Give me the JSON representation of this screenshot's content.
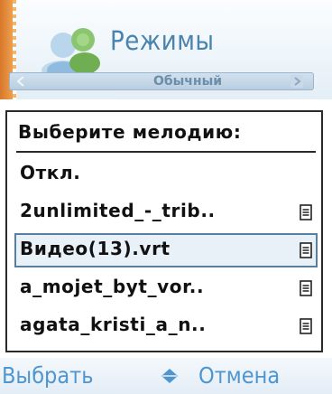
{
  "header": {
    "title": "Режимы",
    "mode_tab": "Обычный"
  },
  "dialog": {
    "heading": "Выберите мелодию:",
    "items": [
      {
        "label": "Откл.",
        "has_file_icon": false,
        "selected": false
      },
      {
        "label": "2unlimited_-_trib..",
        "has_file_icon": true,
        "selected": false
      },
      {
        "label": "Видео(13).vrt",
        "has_file_icon": true,
        "selected": true
      },
      {
        "label": "a_mojet_byt_vor..",
        "has_file_icon": true,
        "selected": false
      },
      {
        "label": "agata_kristi_a_n..",
        "has_file_icon": true,
        "selected": false
      }
    ]
  },
  "softkeys": {
    "left": "Выбрать",
    "right": "Отмена",
    "center_icon": "up-down-arrow-icon"
  },
  "colors": {
    "softkey_text": "#4f95cf",
    "title_text": "#4a83ad",
    "selection_border": "#5a7e9e"
  }
}
